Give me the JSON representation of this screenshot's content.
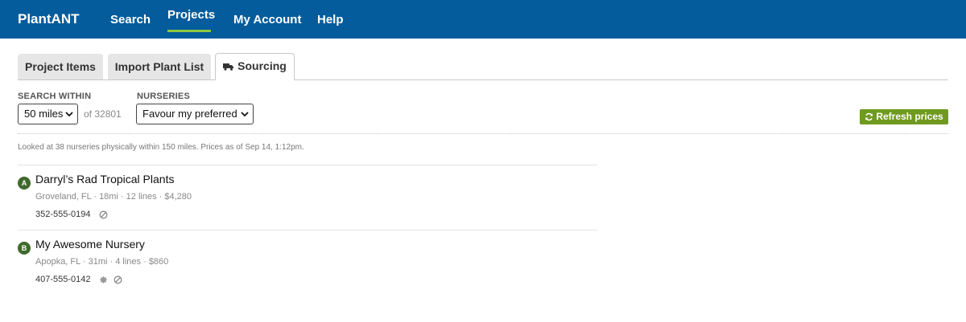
{
  "nav": {
    "brand": "PlantANT",
    "links": [
      {
        "label": "Search"
      },
      {
        "label": "Projects"
      },
      {
        "label": "My Account"
      },
      {
        "label": "Help"
      }
    ],
    "active": "Projects"
  },
  "tabs": [
    {
      "label": "Project Items"
    },
    {
      "label": "Import Plant List"
    },
    {
      "label": "Sourcing",
      "icon": "truck-icon"
    }
  ],
  "active_tab": "Sourcing",
  "filters": {
    "search_within_label": "SEARCH WITHIN",
    "search_within_value": "50 miles",
    "of_zip": "of 32801",
    "nurseries_label": "NURSERIES",
    "nurseries_value": "Favour my preferred"
  },
  "refresh_label": "Refresh prices",
  "status_text": "Looked at 38 nurseries physically within 150 miles. Prices as of Sep 14, 1:12pm.",
  "nurseries": [
    {
      "badge": "A",
      "name": "Darryl’s Rad Tropical Plants",
      "meta": "Groveland, FL · 18mi · 12 lines · $4,280",
      "phone": "352-555-0194",
      "icons": [
        "block-icon"
      ]
    },
    {
      "badge": "B",
      "name": "My Awesome Nursery",
      "meta": "Apopka, FL · 31mi · 4 lines · $860",
      "phone": "407-555-0142",
      "icons": [
        "gear-badge-icon",
        "block-icon"
      ]
    }
  ],
  "colors": {
    "nav_bg": "#045c9c",
    "nav_active_underline": "#8cc63f",
    "refresh_button": "#6f9a1f",
    "badge": "#3f6a2b"
  }
}
